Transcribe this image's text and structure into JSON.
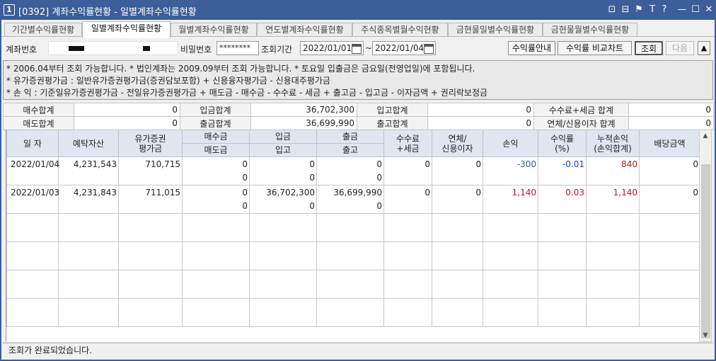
{
  "window": {
    "title_num": "1",
    "title": "[0392] 계좌수익률현황 - 일별계좌수익률현황"
  },
  "titlebar_icons": [
    "link-icon",
    "layout-icon",
    "pin-icon",
    "font-icon",
    "help-icon",
    "minimize-icon",
    "maximize-icon",
    "close-icon"
  ],
  "titlebar_glyphs": [
    "⊡",
    "⊟",
    "⚑",
    "T",
    "?",
    "—",
    "☐",
    "✕"
  ],
  "tabs": [
    "기간별수익률현황",
    "일별계좌수익률현황",
    "월별계좌수익률현황",
    "연도별계좌수익률현황",
    "주식종목별월수익현황",
    "금현물일별수익률현황",
    "금현물월별수익률현황"
  ],
  "active_tab": 1,
  "toolbar": {
    "account_label": "계좌번호",
    "password_label": "비밀번호",
    "password_value": "********",
    "period_label": "조회기간",
    "date_from": "2022/01/01",
    "tilde": "~",
    "date_to": "2022/01/04",
    "guide_button": "수익률안내",
    "chart_button": "수익률 비교차트",
    "query_button": "조회",
    "next_button": "다음",
    "up_arrow": "▲"
  },
  "notes": [
    "* 2006.04부터 조회 가능합니다.   * 법인계좌는 2009.09부터 조회 가능합니다.   * 토요일 입출금은 금요일(전영업일)에 포함됩니다.",
    "* 유가증권평가금 : 일반유가증권평가금(증권담보포함) + 신용융자평가금 - 신용대주평가금",
    "* 손          익 : 기준일유가증권평가금 - 전일유가증권평가금 + 매도금 - 매수금 - 수수료 - 세금 + 출고금 - 입고금 - 이자금액 + 권리락보정금"
  ],
  "summary": {
    "row1": [
      {
        "label": "매수합계",
        "value": "0"
      },
      {
        "label": "입금합계",
        "value": "36,702,300"
      },
      {
        "label": "입고합계",
        "value": "0"
      },
      {
        "label": "수수료+세금 합계",
        "value": "0"
      }
    ],
    "row2": [
      {
        "label": "매도합계",
        "value": "0"
      },
      {
        "label": "출금합계",
        "value": "36,699,990"
      },
      {
        "label": "출고합계",
        "value": "0"
      },
      {
        "label": "연체/신용이자 합계",
        "value": "0"
      }
    ]
  },
  "grid": {
    "headers": {
      "date": "일 자",
      "deposit": "예탁자산",
      "securities": "유가증권\n평가금",
      "buy": "매수금",
      "sell": "매도금",
      "in_cash": "입금",
      "in_stock": "입고",
      "out_cash": "출금",
      "out_stock": "출고",
      "fee": "수수료\n+세금",
      "interest": "연체/\n신용이자",
      "pnl": "손익",
      "rate": "수익률\n(%)",
      "cum": "누적손익\n(손익합계)",
      "dividend": "배당금액"
    },
    "rows": [
      {
        "date": "2022/01/04",
        "deposit": "4,231,543",
        "securities": "710,715",
        "buy": "0",
        "sell": "0",
        "in_cash": "0",
        "in_stock": "0",
        "out_cash": "0",
        "out_stock": "0",
        "fee": "0",
        "interest": "0",
        "pnl": "-300",
        "rate": "-0.01",
        "cum": "840",
        "dividend": "0"
      },
      {
        "date": "2022/01/03",
        "deposit": "4,231,843",
        "securities": "711,015",
        "buy": "0",
        "sell": "0",
        "in_cash": "36,702,300",
        "in_stock": "0",
        "out_cash": "36,699,990",
        "out_stock": "0",
        "fee": "0",
        "interest": "0",
        "pnl": "1,140",
        "rate": "0.03",
        "cum": "1,140",
        "dividend": "0"
      }
    ],
    "colors": {
      "negative": "#1a3fd0",
      "positive": "#c0161b",
      "rate_neg": "#1b6e78"
    }
  },
  "status": "조회가 완료되었습니다."
}
